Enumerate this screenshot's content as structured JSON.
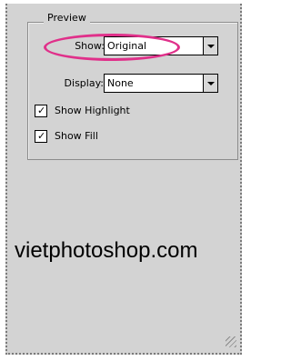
{
  "preview": {
    "group_title": "Preview",
    "show": {
      "label": "Show:",
      "value": "Original"
    },
    "display": {
      "label": "Display:",
      "value": "None"
    },
    "show_highlight": {
      "label": "Show Highlight",
      "checked": true,
      "mark": "✓"
    },
    "show_fill": {
      "label": "Show Fill",
      "checked": true,
      "mark": "✓"
    }
  },
  "watermark": "vietphotoshop.com",
  "colors": {
    "panel": "#d3d3d3",
    "highlight_ring": "#e0308a"
  }
}
